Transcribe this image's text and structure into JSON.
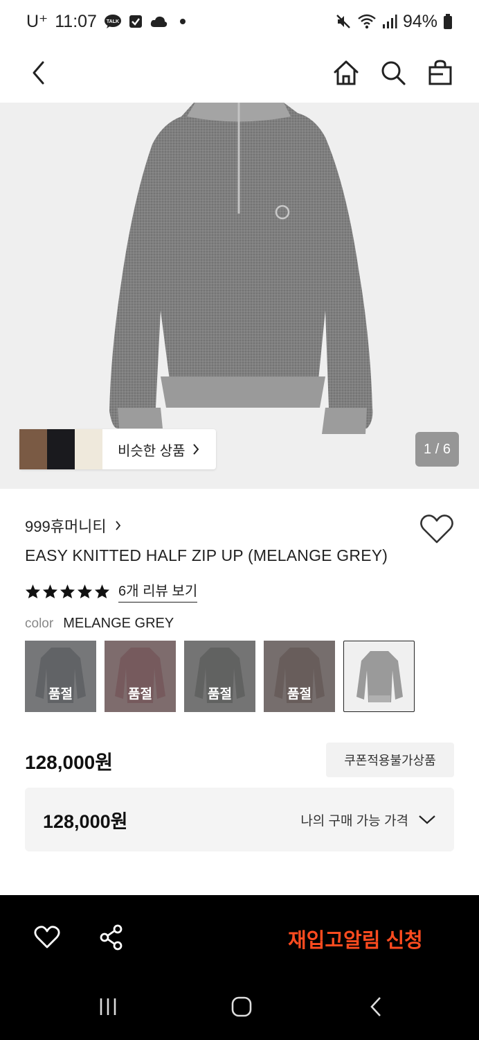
{
  "status_bar": {
    "carrier": "U⁺",
    "time": "11:07",
    "battery": "94%",
    "icons": [
      "talk-icon",
      "check-icon",
      "cloud-icon",
      "mute-icon",
      "wifi-icon",
      "signal-icon",
      "battery-icon"
    ]
  },
  "header": {
    "icons": [
      "back-icon",
      "home-icon",
      "search-icon",
      "shopping-bag-icon"
    ]
  },
  "gallery": {
    "similar_label": "비슷한 상품",
    "page_indicator": "1 / 6"
  },
  "product": {
    "brand": "999휴머니티",
    "title": "EASY KNITTED HALF ZIP UP (MELANGE GREY)",
    "rating_stars": 5,
    "review_link": "6개 리뷰 보기",
    "color_label": "color",
    "color_value": "MELANGE GREY",
    "variants": [
      {
        "label": "품절",
        "color": "#3c4048"
      },
      {
        "label": "품절",
        "color": "#6b2e33"
      },
      {
        "label": "품절",
        "color": "#3d3e3d"
      },
      {
        "label": "품절",
        "color": "#4c3430"
      },
      {
        "label": "",
        "color": "#9a9a9a"
      }
    ],
    "price": "128,000원",
    "coupon_badge": "쿠폰적용불가상품",
    "my_price": "128,000원",
    "my_price_label": "나의 구매 가능 가격"
  },
  "action_bar": {
    "restock_label": "재입고알림 신청",
    "accent_color": "#ff4b1f"
  }
}
